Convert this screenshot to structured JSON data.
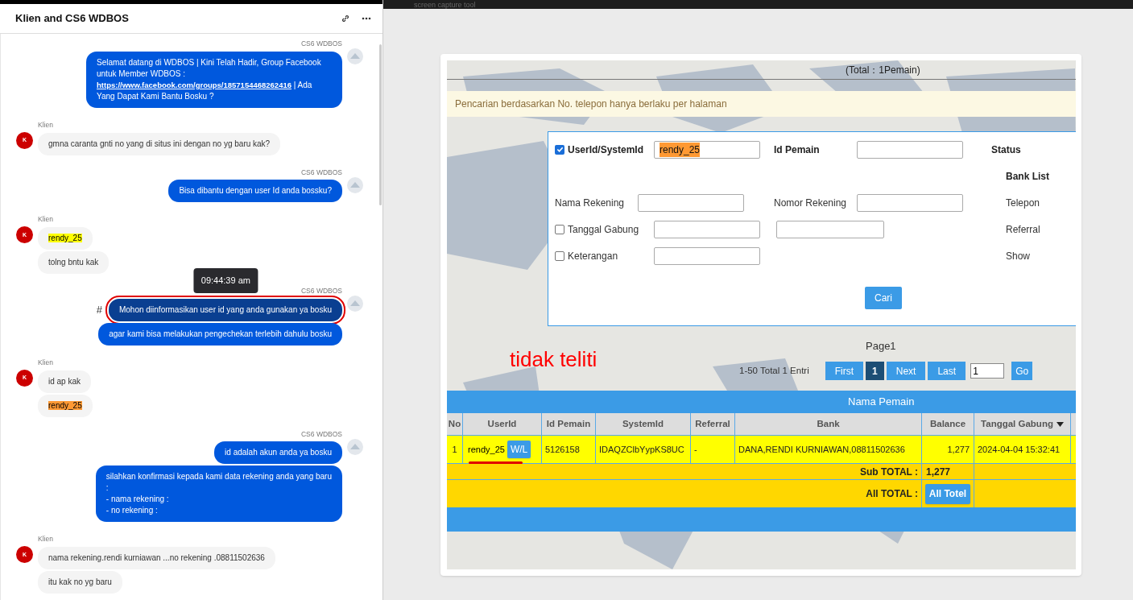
{
  "chat": {
    "title": "Klien and CS6 WDBOS",
    "groups": [
      {
        "kind": "agent",
        "sender": "CS6 WDBOS",
        "bubbles": [
          {
            "selected": false,
            "parts": [
              {
                "kind": "text",
                "text": "Selamat datang di WDBOS | Kini Telah Hadir, Group Facebook untuk Member WDBOS : "
              },
              {
                "kind": "link",
                "text": "https://www.facebook.com/groups/1857154468262416"
              },
              {
                "kind": "text",
                "text": " | Ada Yang Dapat Kami Bantu Bosku ?"
              }
            ]
          }
        ]
      },
      {
        "kind": "client",
        "sender": "Klien",
        "avatar": "K",
        "bubbles": [
          {
            "selected": false,
            "parts": [
              {
                "kind": "text",
                "text": "gmna caranta gnti no yang di situs ini dengan no yg baru kak?"
              }
            ]
          }
        ]
      },
      {
        "kind": "agent",
        "sender": "CS6 WDBOS",
        "bubbles": [
          {
            "selected": false,
            "parts": [
              {
                "kind": "text",
                "text": "Bisa dibantu dengan user Id anda bossku?"
              }
            ]
          }
        ]
      },
      {
        "kind": "client",
        "sender": "Klien",
        "avatar": "K",
        "bubbles": [
          {
            "selected": false,
            "parts": [
              {
                "kind": "text",
                "text": "rendy_25",
                "color": "#ffff00"
              }
            ]
          },
          {
            "selected": false,
            "parts": [
              {
                "kind": "text",
                "text": "tolng bntu kak"
              }
            ]
          }
        ]
      },
      {
        "kind": "agent",
        "sender": "CS6 WDBOS",
        "bubbles": [
          {
            "selected": true,
            "marker": "#",
            "tooltip": "09:44:39 am",
            "parts": [
              {
                "kind": "text",
                "text": "Mohon diinformasikan user id yang anda gunakan ya bosku"
              }
            ]
          },
          {
            "selected": false,
            "parts": [
              {
                "kind": "text",
                "text": "agar kami bisa melakukan pengechekan terlebih dahulu bosku"
              }
            ]
          }
        ]
      },
      {
        "kind": "client",
        "sender": "Klien",
        "avatar": "K",
        "bubbles": [
          {
            "selected": false,
            "parts": [
              {
                "kind": "text",
                "text": "id ap kak"
              }
            ]
          },
          {
            "selected": false,
            "parts": [
              {
                "kind": "text",
                "text": "rendy_25",
                "color": "#ff9933"
              }
            ]
          }
        ]
      },
      {
        "kind": "agent",
        "sender": "CS6 WDBOS",
        "bubbles": [
          {
            "selected": false,
            "parts": [
              {
                "kind": "text",
                "text": "id adalah akun anda ya bosku"
              }
            ]
          },
          {
            "selected": false,
            "parts": [
              {
                "kind": "text",
                "text": "silahkan konfirmasi kepada kami data rekening anda yang baru\n:\n- nama rekening :\n- no rekening :"
              }
            ]
          }
        ]
      },
      {
        "kind": "client",
        "sender": "Klien",
        "avatar": "K",
        "bubbles": [
          {
            "selected": false,
            "parts": [
              {
                "kind": "text",
                "text": "nama rekening.rendi kurniawan ...no rekening .08811502636"
              }
            ]
          },
          {
            "selected": false,
            "parts": [
              {
                "kind": "text",
                "text": "itu kak no yg baru"
              }
            ]
          }
        ]
      }
    ]
  },
  "capture_bar": "screen capture tool",
  "total_line": "(Total：1Pemain)",
  "notice": "Pencarian berdasarkan No. telepon hanya berlaku per halaman",
  "form": {
    "userid": {
      "label": "UserId/SystemId",
      "checked": true,
      "value": "rendy_25"
    },
    "id_pemain": "Id Pemain",
    "status": "Status",
    "bank_list": "Bank List",
    "nama_rekening": "Nama Rekening",
    "nomor_rekening": "Nomor Rekening",
    "telepon": "Telepon",
    "tanggal_gabung": {
      "label": "Tanggal Gabung",
      "checked": false
    },
    "referral": "Referral",
    "keterangan": {
      "label": "Keterangan",
      "checked": false
    },
    "show": "Show",
    "search_button": "Cari"
  },
  "annotation": "tidak teliti",
  "pagination": {
    "page_label": "Page1",
    "summary": "1-50 Total 1 Entri",
    "buttons": [
      {
        "label": "First",
        "selected": false
      },
      {
        "label": "1",
        "selected": true
      },
      {
        "label": "Next",
        "selected": false
      },
      {
        "label": "Last",
        "selected": false
      }
    ],
    "page_input": "1",
    "go": "Go"
  },
  "table": {
    "title": "Nama Pemain",
    "columns": [
      {
        "label": "No",
        "sorted": false
      },
      {
        "label": "UserId",
        "sorted": false
      },
      {
        "label": "Id Pemain",
        "sorted": false
      },
      {
        "label": "SystemId",
        "sorted": false
      },
      {
        "label": "Referral",
        "sorted": false
      },
      {
        "label": "Bank",
        "sorted": false
      },
      {
        "label": "Balance",
        "sorted": false
      },
      {
        "label": "Tanggal Gabung",
        "sorted": true
      }
    ],
    "rows": [
      {
        "no": "1",
        "userid": "rendy_25",
        "wl_button": "W/L",
        "id_pemain": "5126158",
        "systemid": "IDAQZClbYypKS8UC",
        "referral": "-",
        "bank": "DANA,RENDI KURNIAWAN,08811502636",
        "balance": "1,277",
        "tanggal_gabung": "2024-04-04 15:32:41"
      }
    ],
    "subtotal": {
      "label": "Sub TOTAL :",
      "value": "1,277"
    },
    "alltotal": {
      "label": "All TOTAL :",
      "button": "All Totel"
    }
  }
}
